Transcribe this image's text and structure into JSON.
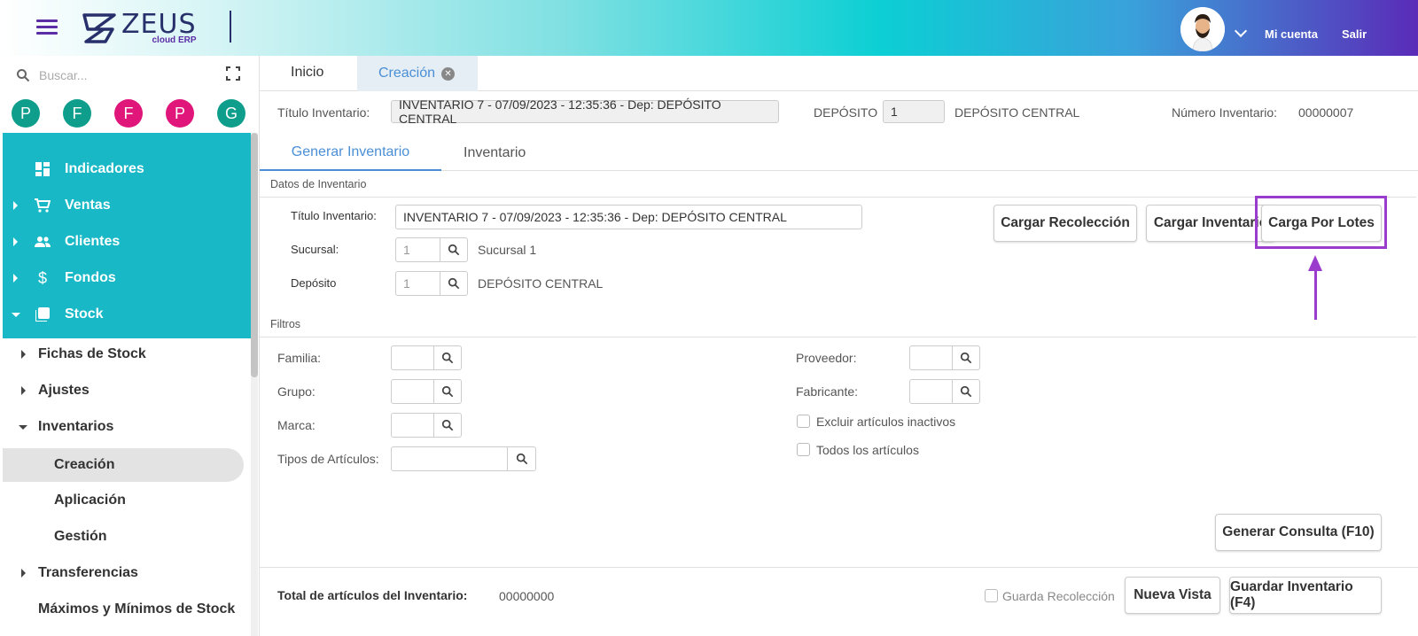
{
  "header": {
    "logo_main": "ZEUS",
    "logo_sub": "cloud ERP",
    "account_label": "Mi cuenta",
    "logout_label": "Salir"
  },
  "sidebar": {
    "search_placeholder": "Buscar...",
    "quick_icons": [
      {
        "letter": "P",
        "color": "#0f9e8c"
      },
      {
        "letter": "F",
        "color": "#0f9e8c"
      },
      {
        "letter": "F",
        "color": "#e0167a"
      },
      {
        "letter": "P",
        "color": "#e0167a"
      },
      {
        "letter": "G",
        "color": "#0f9e8c"
      }
    ],
    "menu": [
      {
        "label": "Indicadores",
        "icon": "dashboard-icon"
      },
      {
        "label": "Ventas",
        "icon": "cart-icon"
      },
      {
        "label": "Clientes",
        "icon": "people-icon"
      },
      {
        "label": "Fondos",
        "icon": "dollar-icon"
      },
      {
        "label": "Stock",
        "icon": "stock-icon"
      }
    ],
    "submenu": [
      {
        "label": "Fichas de Stock"
      },
      {
        "label": "Ajustes"
      },
      {
        "label": "Inventarios"
      },
      {
        "label": "Creación"
      },
      {
        "label": "Aplicación"
      },
      {
        "label": "Gestión"
      },
      {
        "label": "Transferencias"
      },
      {
        "label": "Máximos y Mínimos de Stock"
      }
    ]
  },
  "tabs": {
    "inicio": "Inicio",
    "creacion": "Creación"
  },
  "header_form": {
    "titulo_label": "Título Inventario:",
    "titulo_value": "INVENTARIO 7 - 07/09/2023 - 12:35:36 - Dep: DEPÓSITO CENTRAL",
    "deposito_label": "DEPÓSITO",
    "deposito_value": "1",
    "deposito_name": "DEPÓSITO CENTRAL",
    "numero_label": "Número Inventario:",
    "numero_value": "00000007"
  },
  "subtabs": {
    "generar": "Generar Inventario",
    "inventario": "Inventario"
  },
  "datos": {
    "section_title": "Datos de Inventario",
    "titulo_label": "Título Inventario:",
    "titulo_value": "INVENTARIO 7 - 07/09/2023 - 12:35:36 - Dep: DEPÓSITO CENTRAL",
    "sucursal_label": "Sucursal:",
    "sucursal_code": "1",
    "sucursal_name": "Sucursal 1",
    "deposito_label": "Depósito",
    "deposito_code": "1",
    "deposito_name": "DEPÓSITO CENTRAL",
    "btn_recoleccion": "Cargar Recolección",
    "btn_inventario": "Cargar Inventario",
    "btn_lotes": "Carga Por Lotes"
  },
  "filtros": {
    "section_title": "Filtros",
    "familia": "Familia:",
    "grupo": "Grupo:",
    "marca": "Marca:",
    "tipos": "Tipos de Artículos:",
    "proveedor": "Proveedor:",
    "fabricante": "Fabricante:",
    "excluir": "Excluir artículos inactivos",
    "todos": "Todos los artículos",
    "btn_consulta": "Generar Consulta (F10)"
  },
  "footer": {
    "total_label": "Total de artículos del Inventario:",
    "total_value": "00000000",
    "guarda_label": "Guarda Recolección",
    "btn_nueva": "Nueva Vista",
    "btn_guardar": "Guardar Inventario (F4)"
  }
}
